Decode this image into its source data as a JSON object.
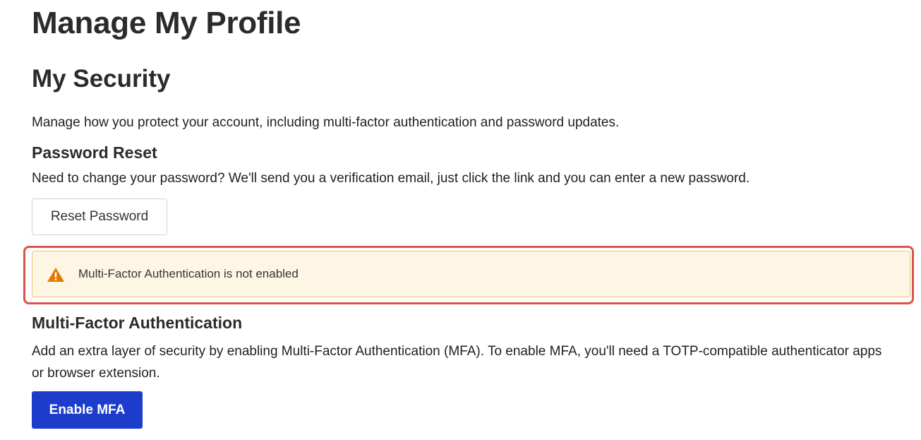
{
  "page": {
    "title": "Manage My Profile"
  },
  "security": {
    "title": "My Security",
    "intro": "Manage how you protect your account, including multi-factor authentication and password updates."
  },
  "password_reset": {
    "title": "Password Reset",
    "description": "Need to change your password? We'll send you a verification email, just click the link and you can enter a new password.",
    "button_label": "Reset Password"
  },
  "alert": {
    "icon": "warning-icon",
    "message": "Multi-Factor Authentication is not enabled",
    "background_color": "#fdf6e4",
    "border_color": "#e8c372",
    "icon_color": "#e07b00",
    "highlight_color": "#d9544a"
  },
  "mfa": {
    "title": "Multi-Factor Authentication",
    "description": "Add an extra layer of security by enabling Multi-Factor Authentication (MFA). To enable MFA, you'll need a TOTP-compatible authenticator apps or browser extension.",
    "button_label": "Enable MFA",
    "button_color": "#1c3ccc"
  }
}
